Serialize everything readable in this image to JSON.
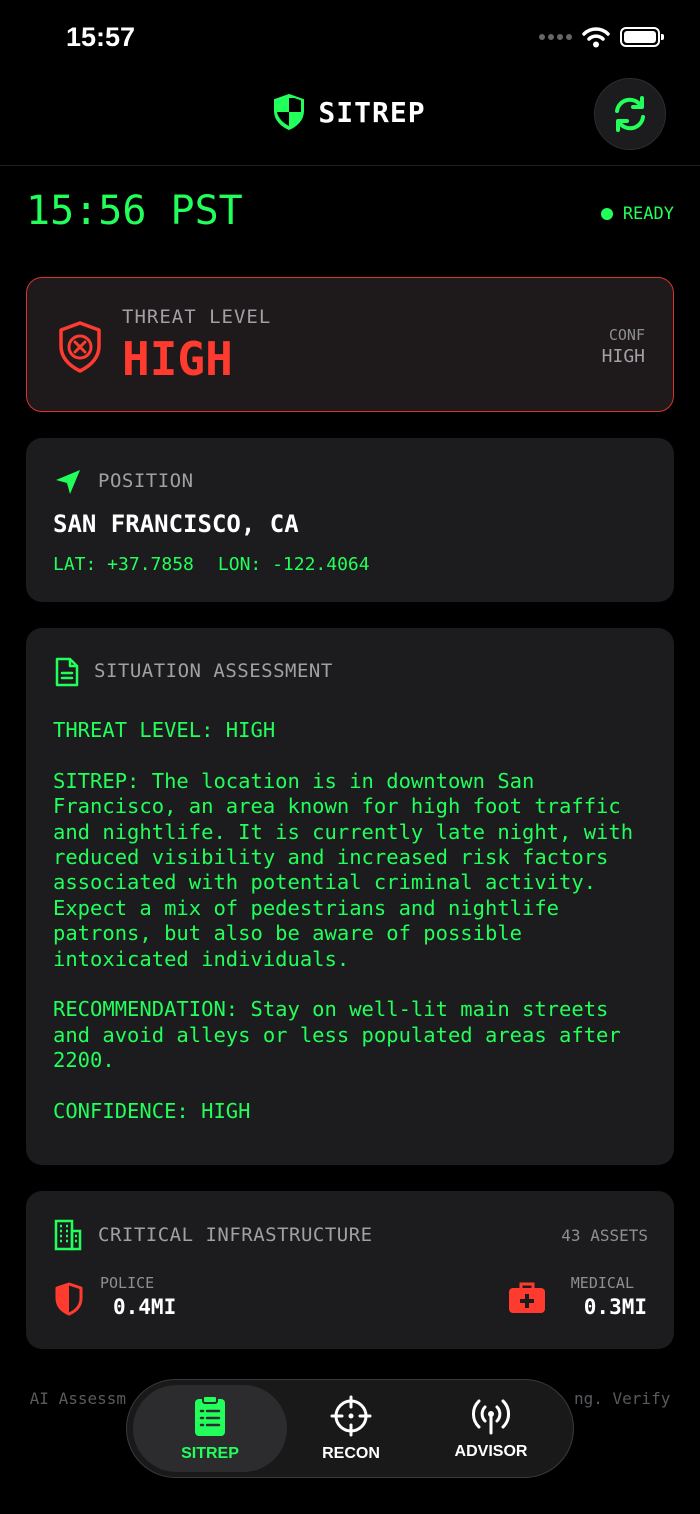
{
  "status_bar": {
    "time": "15:57"
  },
  "header": {
    "title": "SITREP"
  },
  "clock": {
    "time": "15:56 PST",
    "status": "READY"
  },
  "threat": {
    "label": "THREAT LEVEL",
    "value": "HIGH",
    "conf_label": "CONF",
    "conf_value": "HIGH"
  },
  "position": {
    "title": "POSITION",
    "city": "SAN FRANCISCO, CA",
    "lat": "LAT: +37.7858",
    "lon": "LON: -122.4064"
  },
  "assessment": {
    "title": "SITUATION ASSESSMENT",
    "threat_line": "THREAT LEVEL: HIGH",
    "sitrep": "SITREP: The location is in downtown San Francisco, an area known for high foot traffic and nightlife. It is currently late night, with reduced visibility and increased risk factors associated with potential criminal activity. Expect a mix of pedestrians and nightlife patrons, but also be aware of possible intoxicated individuals.",
    "recommendation": "RECOMMENDATION: Stay on well-lit main streets and avoid alleys or less populated areas after 2200.",
    "confidence": "CONFIDENCE: HIGH"
  },
  "infrastructure": {
    "title": "CRITICAL INFRASTRUCTURE",
    "count": "43 ASSETS",
    "police": {
      "label": "POLICE",
      "value": "0.4MI"
    },
    "medical": {
      "label": "MEDICAL",
      "value": "0.3MI"
    }
  },
  "disclaimer": "AI Assessm",
  "disclaimer_tail": "ng. Verify",
  "tabs": [
    {
      "label": "SITREP",
      "icon": "clipboard-icon"
    },
    {
      "label": "RECON",
      "icon": "crosshair-icon"
    },
    {
      "label": "ADVISOR",
      "icon": "antenna-icon"
    }
  ],
  "colors": {
    "accent": "#22ff5a",
    "danger": "#ff3b30",
    "card": "#1c1c1e",
    "background": "#000000"
  }
}
